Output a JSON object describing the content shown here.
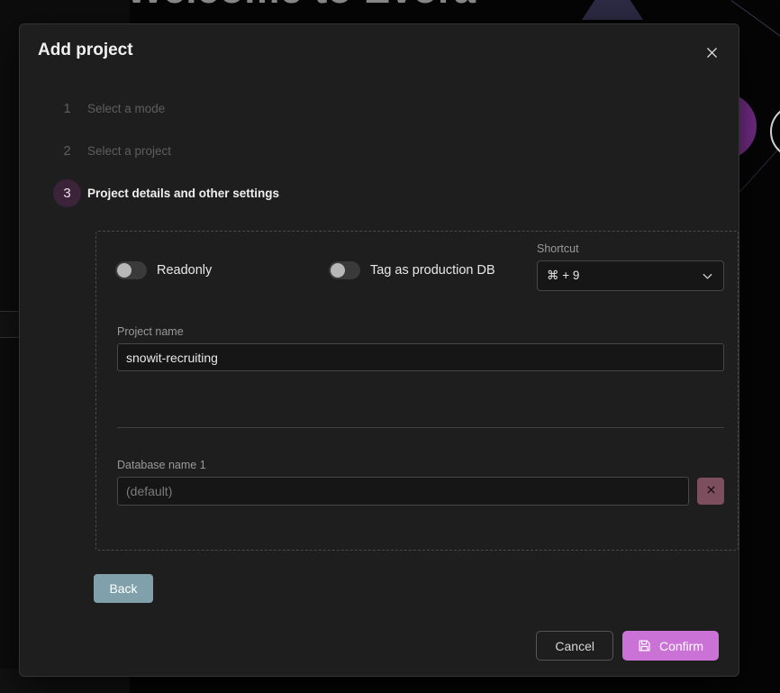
{
  "background": {
    "hero_title": "Welcome to Evora"
  },
  "modal": {
    "title": "Add project",
    "close_icon": "close-icon",
    "steps": [
      {
        "index": "1",
        "label": "Select a mode",
        "active": false
      },
      {
        "index": "2",
        "label": "Select a project",
        "active": false
      },
      {
        "index": "3",
        "label": "Project details and other settings",
        "active": true
      }
    ],
    "settings": {
      "readonly_toggle": {
        "label": "Readonly",
        "value": "off"
      },
      "production_toggle": {
        "label": "Tag as production DB",
        "value": "off"
      },
      "shortcut": {
        "label": "Shortcut",
        "value": "⌘ + 9",
        "chevron_icon": "chevron-down-icon"
      },
      "project_name": {
        "label": "Project name",
        "value": "snowit-recruiting",
        "placeholder": "Project name"
      },
      "database": {
        "label": "Database name 1",
        "value": "",
        "placeholder": "(default)",
        "remove_icon": "close-icon"
      }
    },
    "back_label": "Back",
    "footer": {
      "cancel_label": "Cancel",
      "confirm_label": "Confirm",
      "confirm_icon": "save-icon"
    }
  },
  "colors": {
    "modal_bg": "#1e1e1e",
    "accent_confirm": "#cb72d6",
    "accent_step_badge": "#3b2439",
    "accent_back": "#80a0ac",
    "accent_remove": "#7d4f5e",
    "page_bg": "#050505"
  }
}
